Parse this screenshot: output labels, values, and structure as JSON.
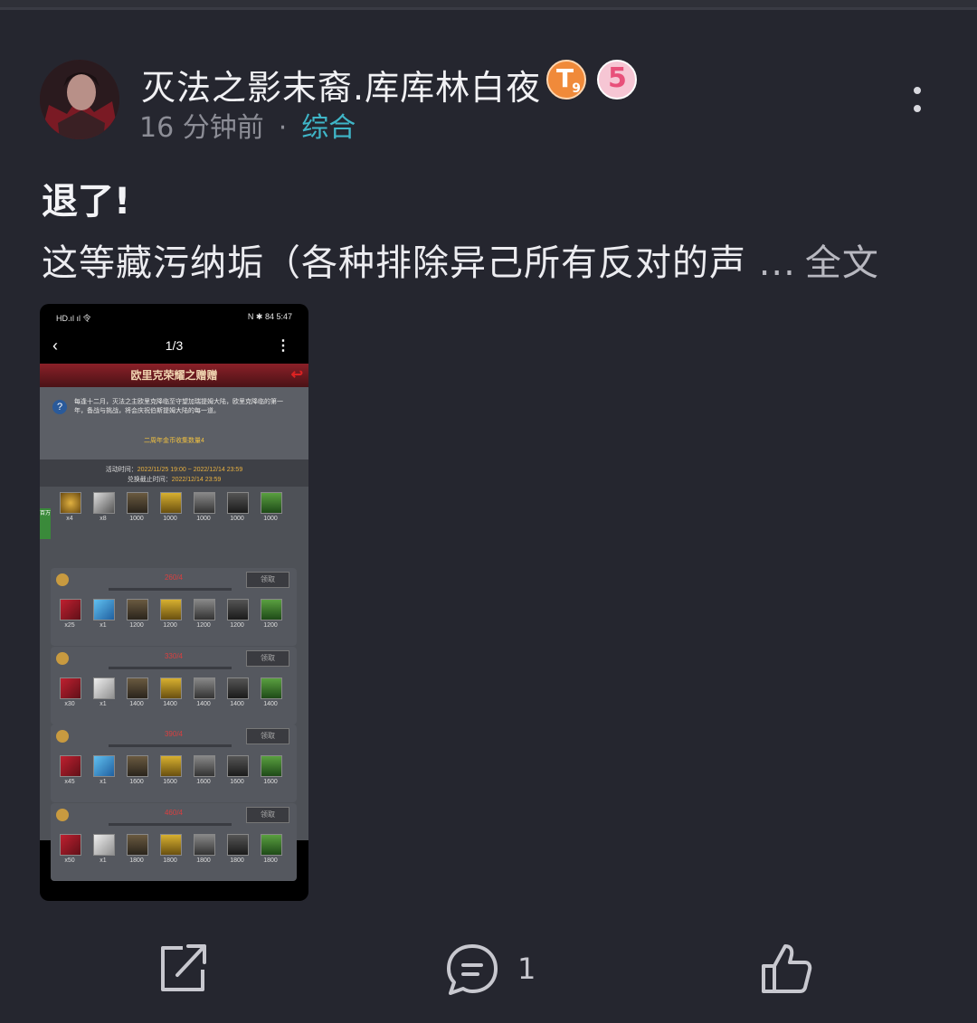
{
  "post": {
    "author": "灭法之影末裔.库库林白夜",
    "badges": {
      "level_badge": "T",
      "level_sub": "9",
      "rank_badge": "5"
    },
    "time": "16 分钟前",
    "separator": "·",
    "category": "综合",
    "title": "退了!",
    "body_preview": "这等藏污纳垢（各种排除异己所有反对的声",
    "ellipsis": "...",
    "expand_label": "全文"
  },
  "screenshot": {
    "status_left": "HD.ıl ıl 令",
    "status_right": "N ✱ 84 5:47",
    "page_counter": "1/3",
    "game_title": "欧里克荣耀之赠赠",
    "desc_text": "每逢十二月，灭法之主欧里克降临至守望加瑞提姆大陆，欧里克降临的第一年，备战与挑战，将会庆祝伯斯提姆大陆的每一道。",
    "gold_text": "二周年金币收集数量4",
    "event_label": "活动时间：",
    "event_time": "2022/11/25 19:00 ~ 2022/12/14 23:59",
    "claim_label": "兑换截止时间：",
    "claim_time": "2022/12/14 23:59",
    "side_tab": "百万",
    "claim_button": "领取",
    "top_items": [
      "x4",
      "x8",
      "1000",
      "1000",
      "1000",
      "1000",
      "1000"
    ],
    "tiers": [
      {
        "need": "260/4",
        "items": [
          "x25",
          "x1",
          "1200",
          "1200",
          "1200",
          "1200",
          "1200"
        ]
      },
      {
        "need": "330/4",
        "items": [
          "x30",
          "x1",
          "1400",
          "1400",
          "1400",
          "1400",
          "1400"
        ]
      },
      {
        "need": "390/4",
        "items": [
          "x45",
          "x1",
          "1600",
          "1600",
          "1600",
          "1600",
          "1600"
        ]
      },
      {
        "need": "460/4",
        "items": [
          "x50",
          "x1",
          "1800",
          "1800",
          "1800",
          "1800",
          "1800"
        ]
      }
    ]
  },
  "actions": {
    "comment_count": "1"
  },
  "colors": {
    "background": "#25262f",
    "category": "#3fb6c8",
    "muted": "#8c8d96"
  }
}
